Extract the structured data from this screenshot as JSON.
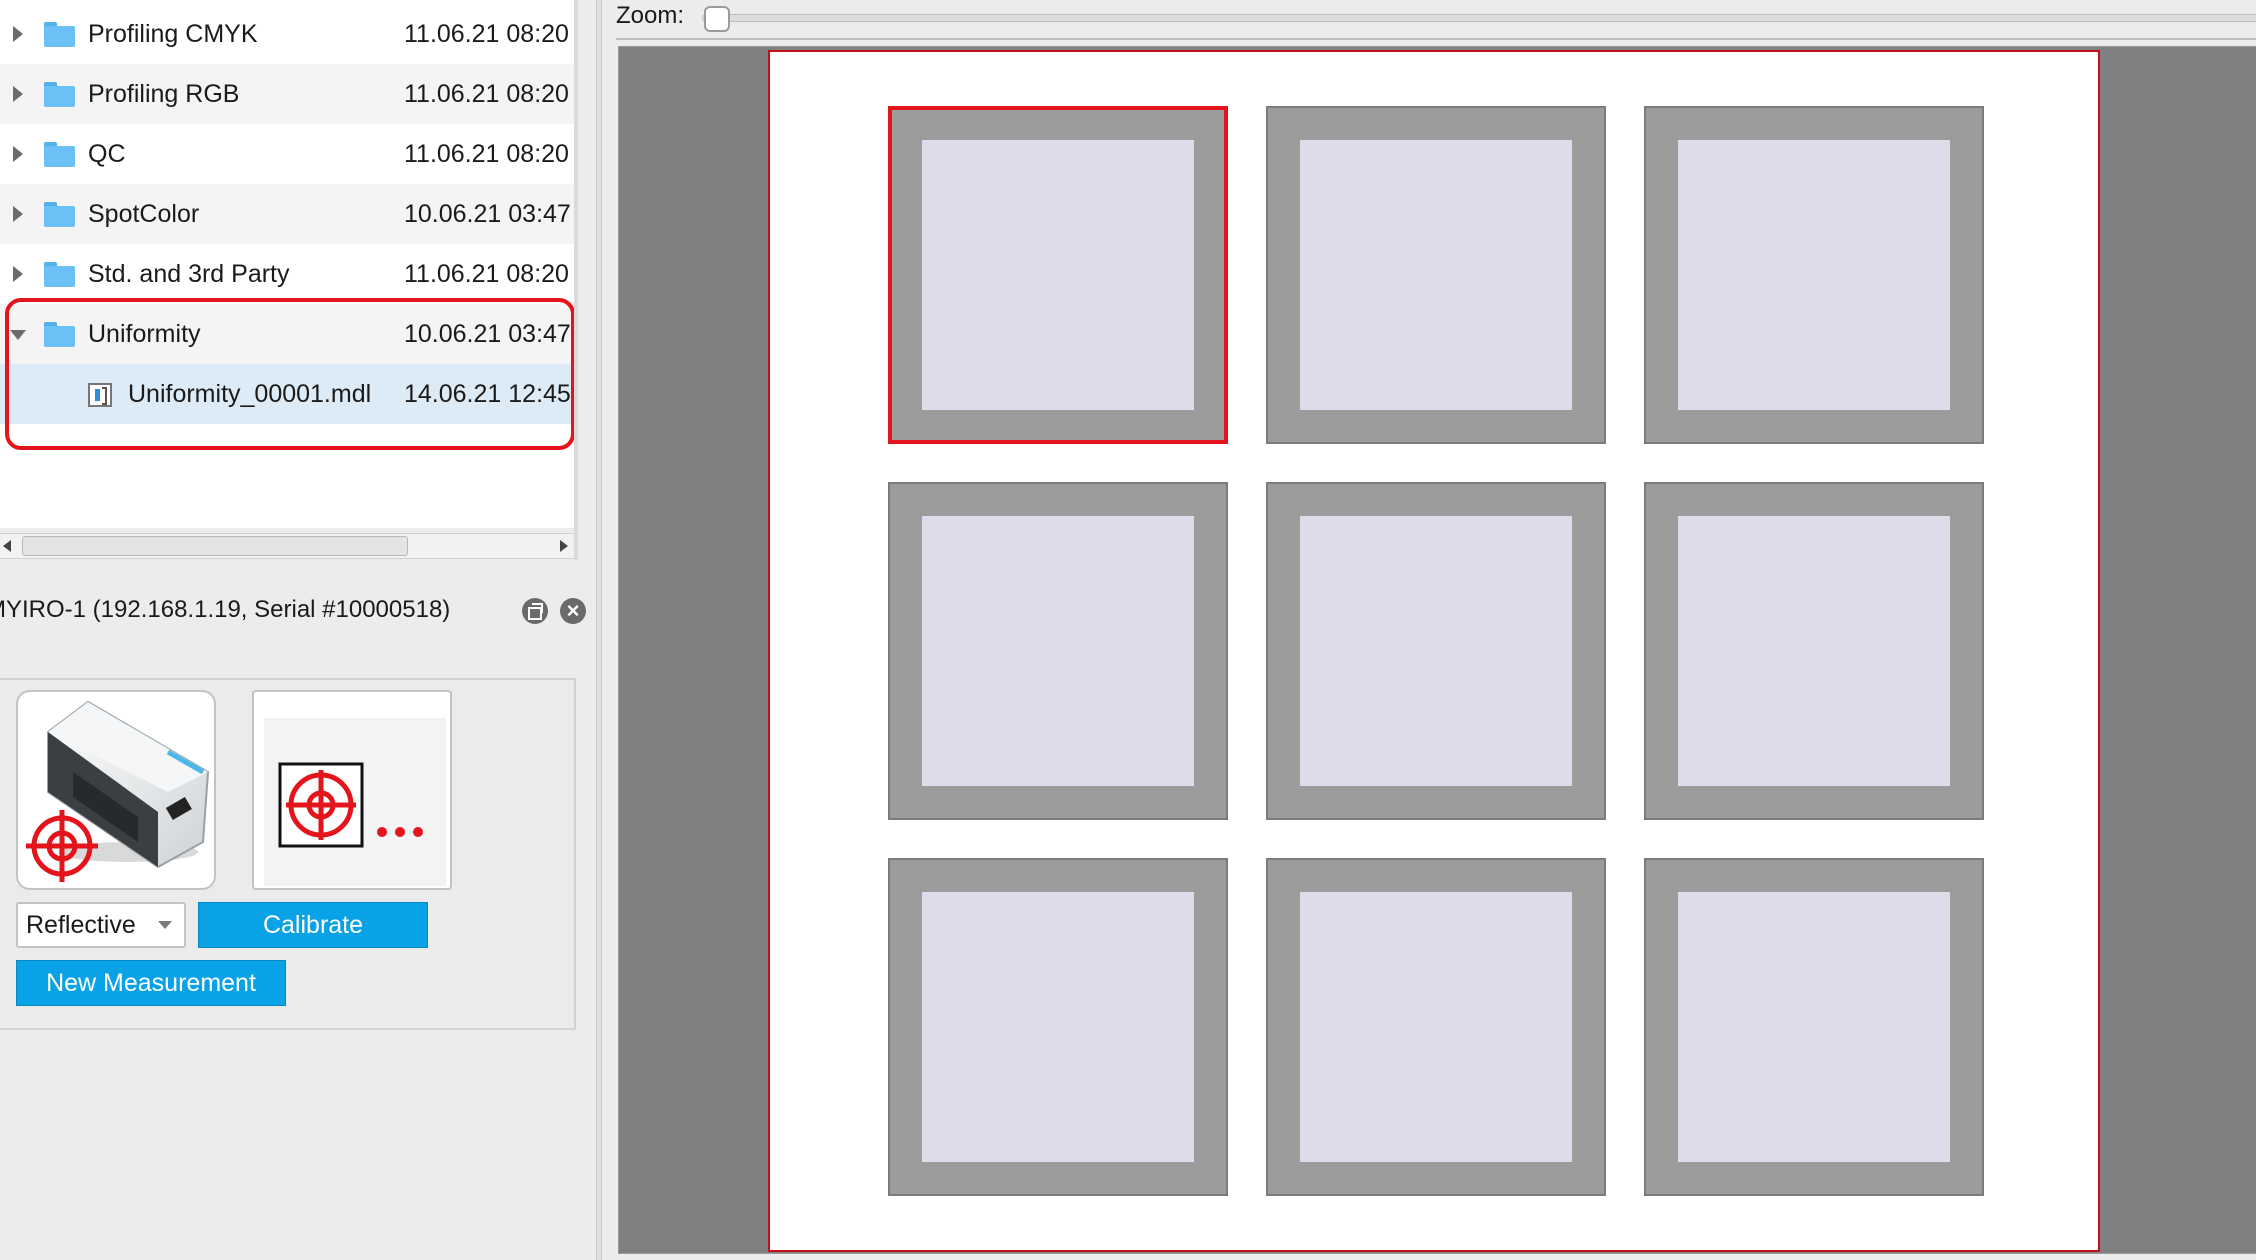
{
  "tree": {
    "rows": [
      {
        "name": "Profiling CMYK",
        "date": "11.06.21 08:20"
      },
      {
        "name": "Profiling RGB",
        "date": "11.06.21 08:20"
      },
      {
        "name": "QC",
        "date": "11.06.21 08:20"
      },
      {
        "name": "SpotColor",
        "date": "10.06.21 03:47"
      },
      {
        "name": "Std. and 3rd Party",
        "date": "11.06.21 08:20"
      },
      {
        "name": "Uniformity",
        "date": "10.06.21 03:47"
      }
    ],
    "child": {
      "name": "Uniformity_00001.mdl",
      "date": "14.06.21 12:45"
    }
  },
  "device": {
    "title": "MYIRO-1 (192.168.1.19, Serial #10000518)",
    "mode": "Reflective",
    "calibrate_label": "Calibrate",
    "new_measurement_label": "New Measurement"
  },
  "viewer": {
    "zoom_label": "Zoom:",
    "zoom_level": 0,
    "patch_grid": {
      "rows": 3,
      "cols": 3,
      "selected_index": 0
    },
    "colors": {
      "patch_border": "#9c9c9c",
      "patch_fill": "#dcdcea",
      "selection": "#e3141b",
      "sheet_border": "#c0101a"
    }
  },
  "icons": {
    "folder": "folder-icon",
    "file": "mdl-file-icon",
    "target": "crosshair-target-icon",
    "device": "spectrophotometer-icon"
  }
}
